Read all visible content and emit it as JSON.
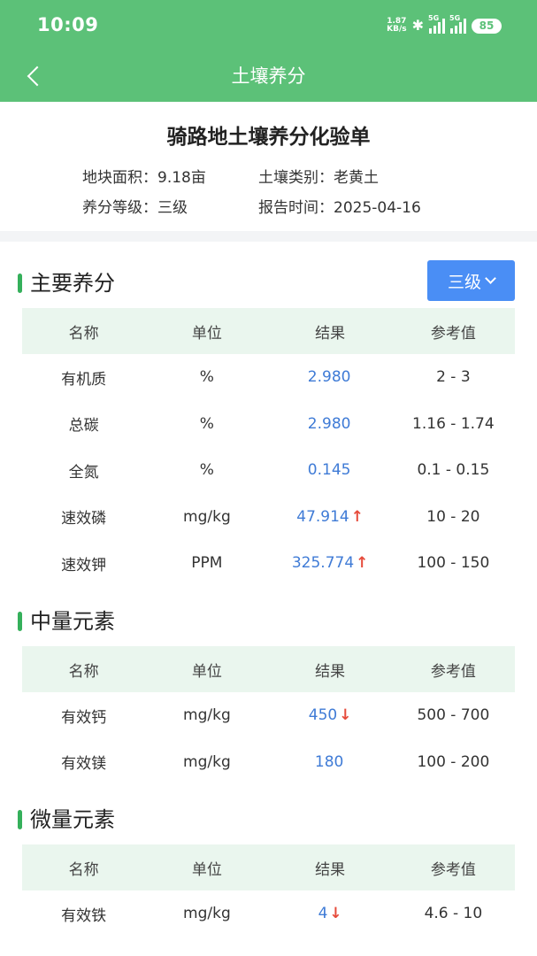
{
  "status_bar": {
    "time": "10:09",
    "net_speed_value": "1.87",
    "net_speed_unit": "KB/s",
    "bluetooth_icon": "bluetooth-icon",
    "sim1_label": "5G",
    "sim2_label": "5G",
    "battery": "85"
  },
  "nav": {
    "title": "土壤养分",
    "back_icon": "chevron-left-icon"
  },
  "report": {
    "title": "骑路地土壤养分化验单",
    "area_label": "地块面积：",
    "area_value": "9.18亩",
    "soil_type_label": "土壤类别：",
    "soil_type_value": "老黄土",
    "grade_label": "养分等级：",
    "grade_value": "三级",
    "date_label": "报告时间：",
    "date_value": "2025-04-16"
  },
  "colors": {
    "header_green": "#5cc178",
    "accent_blue": "#4a8ef5",
    "result_blue": "#3f7bd6",
    "arrow_red": "#e64b3b",
    "table_header_bg": "#eaf6ee"
  },
  "level_dropdown": {
    "selected": "三级",
    "icon": "chevron-down-icon"
  },
  "table_headers": [
    "名称",
    "单位",
    "结果",
    "参考值"
  ],
  "sections": {
    "main": {
      "title": "主要养分",
      "rows": [
        {
          "name": "有机质",
          "unit": "%",
          "result": "2.980",
          "arrow": "",
          "ref": "2 - 3"
        },
        {
          "name": "总碳",
          "unit": "%",
          "result": "2.980",
          "arrow": "",
          "ref": "1.16 - 1.74"
        },
        {
          "name": "全氮",
          "unit": "%",
          "result": "0.145",
          "arrow": "",
          "ref": "0.1 - 0.15"
        },
        {
          "name": "速效磷",
          "unit": "mg/kg",
          "result": "47.914",
          "arrow": "↑",
          "ref": "10 - 20"
        },
        {
          "name": "速效钾",
          "unit": "PPM",
          "result": "325.774",
          "arrow": "↑",
          "ref": "100 - 150"
        }
      ]
    },
    "medium": {
      "title": "中量元素",
      "rows": [
        {
          "name": "有效钙",
          "unit": "mg/kg",
          "result": "450",
          "arrow": "↓",
          "ref": "500 - 700"
        },
        {
          "name": "有效镁",
          "unit": "mg/kg",
          "result": "180",
          "arrow": "",
          "ref": "100 - 200"
        }
      ]
    },
    "micro": {
      "title": "微量元素",
      "rows": [
        {
          "name": "有效铁",
          "unit": "mg/kg",
          "result": "4",
          "arrow": "↓",
          "ref": "4.6 - 10"
        }
      ]
    }
  }
}
